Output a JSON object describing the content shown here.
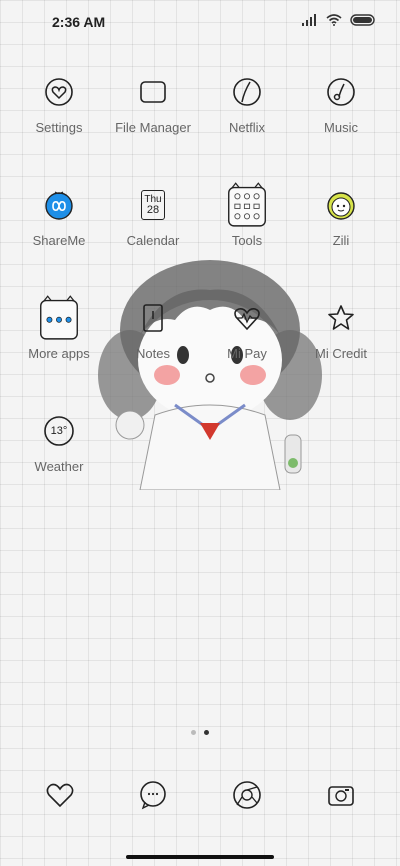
{
  "status_bar": {
    "time": "2:36 AM",
    "icons": [
      "signal-icon",
      "wifi-icon",
      "battery-icon"
    ]
  },
  "apps": [
    {
      "label": "Settings",
      "icon": "heart-circle-icon"
    },
    {
      "label": "File Manager",
      "icon": "folder-icon"
    },
    {
      "label": "Netflix",
      "icon": "netflix-icon"
    },
    {
      "label": "Music",
      "icon": "music-note-icon"
    },
    {
      "label": "ShareMe",
      "icon": "shareme-icon"
    },
    {
      "label": "Calendar",
      "icon": "calendar-icon",
      "day": "Thu",
      "date": "28"
    },
    {
      "label": "Tools",
      "icon": "tools-folder-icon"
    },
    {
      "label": "Zili",
      "icon": "zili-icon"
    },
    {
      "label": "More apps",
      "icon": "more-apps-folder-icon"
    },
    {
      "label": "Notes",
      "icon": "notes-icon"
    },
    {
      "label": "Mi Pay",
      "icon": "heart-pulse-icon"
    },
    {
      "label": "Mi Credit",
      "icon": "star-icon"
    },
    {
      "label": "Weather",
      "icon": "weather-icon",
      "temp": "13°"
    }
  ],
  "page_indicator": {
    "count": 2,
    "active": 2
  },
  "dock": [
    "heart-icon",
    "message-icon",
    "browser-icon",
    "camera-icon"
  ],
  "colors": {
    "accent_blue": "#1e8fe8",
    "zili_yellow": "#d7e34a",
    "blush": "#f3a3a3",
    "tie_red": "#d2382e"
  }
}
